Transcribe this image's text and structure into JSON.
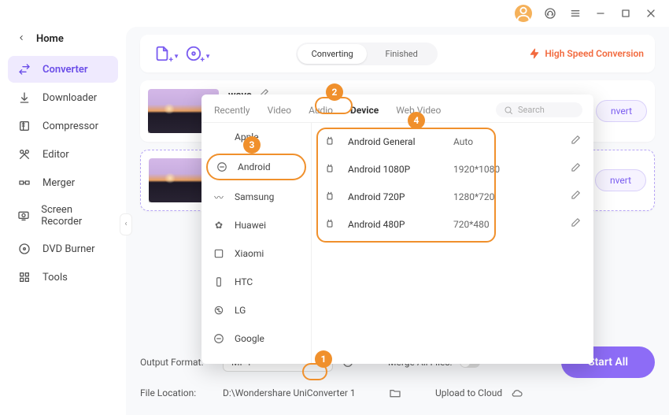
{
  "titlebar": {
    "avatar_initial": ""
  },
  "sidebar": {
    "back_label": "Home",
    "items": [
      {
        "label": "Converter",
        "active": true
      },
      {
        "label": "Downloader"
      },
      {
        "label": "Compressor"
      },
      {
        "label": "Editor"
      },
      {
        "label": "Merger"
      },
      {
        "label": "Screen Recorder"
      },
      {
        "label": "DVD Burner"
      },
      {
        "label": "Tools"
      }
    ]
  },
  "topbar": {
    "seg_converting": "Converting",
    "seg_finished": "Finished",
    "high_speed": "High Speed Conversion"
  },
  "cards": {
    "title1": "wave",
    "convert_label": "nvert"
  },
  "panel": {
    "tabs": {
      "recently": "Recently",
      "video": "Video",
      "audio": "Audio",
      "device": "Device",
      "webvideo": "Web Video"
    },
    "search_placeholder": "Search",
    "brands": [
      {
        "label": "Apple"
      },
      {
        "label": "Android",
        "selected": true
      },
      {
        "label": "Samsung"
      },
      {
        "label": "Huawei"
      },
      {
        "label": "Xiaomi"
      },
      {
        "label": "HTC"
      },
      {
        "label": "LG"
      },
      {
        "label": "Google"
      }
    ],
    "presets": [
      {
        "name": "Android General",
        "res": "Auto"
      },
      {
        "name": "Android 1080P",
        "res": "1920*1080"
      },
      {
        "name": "Android 720P",
        "res": "1280*720"
      },
      {
        "name": "Android 480P",
        "res": "720*480"
      }
    ]
  },
  "bottom": {
    "output_format_label": "Output Format:",
    "output_format_value": "MP4",
    "merge_label": "Merge All Files:",
    "file_location_label": "File Location:",
    "file_location_value": "D:\\Wondershare UniConverter 1",
    "upload_label": "Upload to Cloud",
    "start_all": "Start All"
  },
  "badges": {
    "b1": "1",
    "b2": "2",
    "b3": "3",
    "b4": "4"
  }
}
